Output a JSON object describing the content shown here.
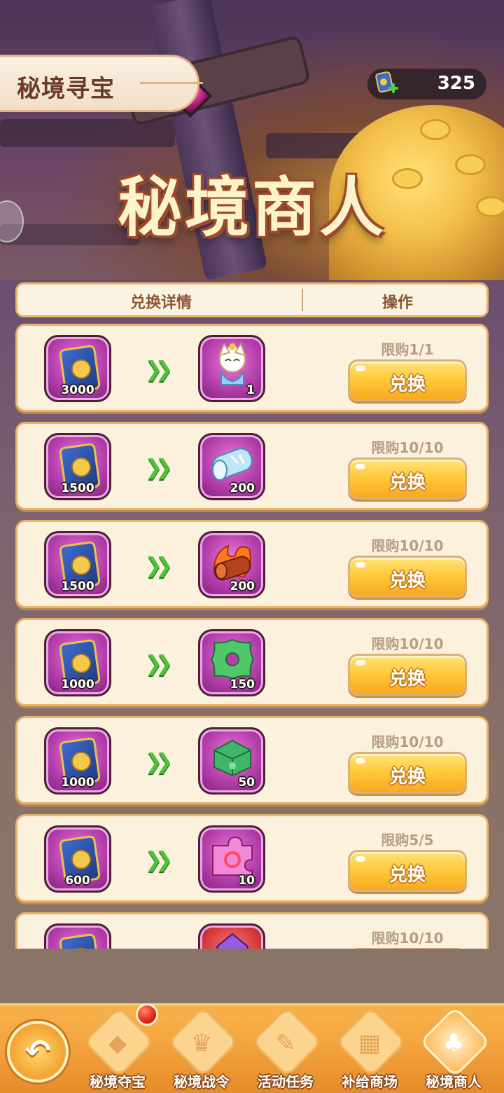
{
  "header_tab": {
    "title": "秘境寻宝"
  },
  "currency": {
    "value": "325",
    "icon": "ticket-plus-icon"
  },
  "banner": {
    "title": "秘境商人"
  },
  "table_header": {
    "details": "兑换详情",
    "action": "操作"
  },
  "rows": [
    {
      "cost": "3000",
      "reward": "1",
      "reward_icon": "character-icon",
      "limit": "限购1/1",
      "button": "兑换"
    },
    {
      "cost": "1500",
      "reward": "200",
      "reward_icon": "ice-log-icon",
      "limit": "限购10/10",
      "button": "兑换"
    },
    {
      "cost": "1500",
      "reward": "200",
      "reward_icon": "fire-log-icon",
      "limit": "限购10/10",
      "button": "兑换"
    },
    {
      "cost": "1000",
      "reward": "150",
      "reward_icon": "jade-ring-icon",
      "limit": "限购10/10",
      "button": "兑换"
    },
    {
      "cost": "1000",
      "reward": "50",
      "reward_icon": "jade-block-icon",
      "limit": "限购10/10",
      "button": "兑换"
    },
    {
      "cost": "600",
      "reward": "10",
      "reward_icon": "puzzle-fragment-icon",
      "limit": "限购5/5",
      "button": "兑换"
    },
    {
      "cost": "",
      "reward": "",
      "reward_icon": "purple-crystal-icon",
      "limit": "限购10/10",
      "button": ""
    }
  ],
  "nav": {
    "back_icon": "back-arrow-icon",
    "tabs": [
      {
        "label": "秘境夺宝",
        "icon": "treasure-icon"
      },
      {
        "label": "秘境战令",
        "icon": "crown-icon"
      },
      {
        "label": "活动任务",
        "icon": "scroll-icon"
      },
      {
        "label": "补给商场",
        "icon": "shop-icon"
      },
      {
        "label": "秘境商人",
        "icon": "bag-icon"
      }
    ]
  },
  "colors": {
    "accent": "#ffcb3c",
    "panel": "#fbf1dc",
    "border": "#e7b46a",
    "nav": "#f5a640"
  }
}
